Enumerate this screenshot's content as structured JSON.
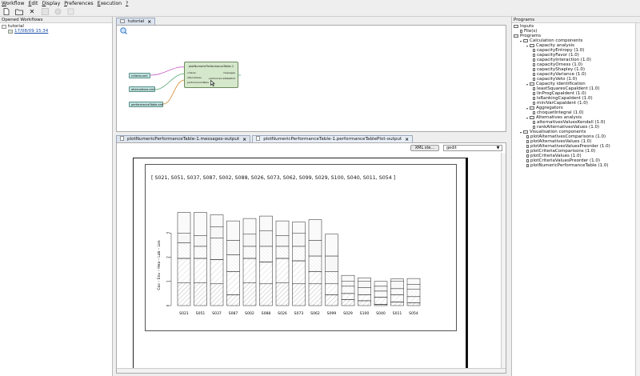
{
  "menu": [
    "Workflow",
    "Edit",
    "Display",
    "Preferences",
    "Execution",
    "?"
  ],
  "menu_underline_index": [
    0,
    0,
    0,
    0,
    0,
    0
  ],
  "left_panel": {
    "title": "Opened Workflows",
    "root": "tutorial",
    "child": "17/08/09 15:34"
  },
  "workflow_tab": "tutorial",
  "workflow": {
    "nodes": {
      "criteria": "criteria.xml",
      "alternatives": "alternatives.xml",
      "performanceTable": "performanceTable.xml",
      "plot": "plotNumericPerformanceTable-1"
    },
    "ports": {
      "in1": "criteria",
      "in2": "alternatives",
      "in3": "performanceTable",
      "out1": "messages",
      "out2": "performanceTablePlot"
    }
  },
  "output_tabs": [
    "plotNumericPerformanceTable-1.messages-output",
    "plotNumericPerformanceTable-1.performanceTablePlot-output"
  ],
  "output_toolbar": {
    "xml_button": "XML ste...",
    "viewer_select": "gedit"
  },
  "chart_data": {
    "type": "bar",
    "title": "[ S021, S051, S037, S087, S002, S088, S026, S073, S062, S099, S029, S100, S040, S011, S054 ]",
    "ylabel": "Cos – Env – Hea – Lab – Lon",
    "categories": [
      "S021",
      "S051",
      "S037",
      "S087",
      "S002",
      "S088",
      "S026",
      "S073",
      "S062",
      "S099",
      "S029",
      "S100",
      "S040",
      "S011",
      "S054"
    ],
    "series": [
      {
        "values": [
          0.95,
          0.95,
          0.9,
          0.45,
          0.95,
          0.9,
          0.95,
          0.9,
          0.9,
          0.45,
          0.25,
          0.2,
          0.05,
          0.15,
          0.12
        ]
      },
      {
        "values": [
          1.0,
          1.0,
          1.0,
          0.95,
          1.0,
          0.9,
          1.0,
          0.95,
          0.5,
          0.45,
          0.25,
          0.25,
          0.3,
          0.3,
          0.25
        ]
      },
      {
        "values": [
          0.65,
          0.5,
          0.9,
          0.7,
          0.5,
          0.65,
          0.5,
          0.6,
          0.65,
          0.5,
          0.3,
          0.3,
          0.25,
          0.25,
          0.3
        ]
      },
      {
        "values": [
          0.4,
          0.45,
          0.45,
          0.6,
          0.5,
          0.65,
          0.45,
          0.55,
          0.65,
          0.65,
          0.2,
          0.25,
          0.2,
          0.3,
          0.2
        ]
      },
      {
        "values": [
          0.85,
          0.95,
          0.5,
          0.8,
          0.65,
          0.6,
          0.6,
          0.45,
          0.85,
          0.9,
          0.25,
          0.15,
          0.2,
          0.1,
          0.25
        ]
      }
    ],
    "ylim": [
      0,
      4
    ],
    "yticks": [
      "0",
      "1",
      "2",
      "3",
      "4"
    ]
  },
  "right_panel": {
    "title": "Programs",
    "items": [
      {
        "level": 0,
        "type": "folder",
        "label": "Inputs"
      },
      {
        "level": 1,
        "type": "leaf",
        "label": "File(s)"
      },
      {
        "level": 0,
        "type": "folder",
        "label": "Programs"
      },
      {
        "level": 1,
        "type": "folder",
        "label": "Calculation components"
      },
      {
        "level": 2,
        "type": "folder",
        "label": "Capacity analysis"
      },
      {
        "level": 3,
        "type": "leaf",
        "label": "capacityEntropy (1.0)"
      },
      {
        "level": 3,
        "type": "leaf",
        "label": "capacityFavor (1.0)"
      },
      {
        "level": 3,
        "type": "leaf",
        "label": "capacityInteraction (1.0)"
      },
      {
        "level": 3,
        "type": "leaf",
        "label": "capacityOrness (1.0)"
      },
      {
        "level": 3,
        "type": "leaf",
        "label": "capacityShapley (1.0)"
      },
      {
        "level": 3,
        "type": "leaf",
        "label": "capacityVariance (1.0)"
      },
      {
        "level": 3,
        "type": "leaf",
        "label": "capacityVeto (1.0)"
      },
      {
        "level": 2,
        "type": "folder",
        "label": "Capacity identification"
      },
      {
        "level": 3,
        "type": "leaf",
        "label": "leastSquaresCapaIdent (1.0)"
      },
      {
        "level": 3,
        "type": "leaf",
        "label": "linProgCapaIdent (1.0)"
      },
      {
        "level": 3,
        "type": "leaf",
        "label": "lsRankingCapaIdent (1.0)"
      },
      {
        "level": 3,
        "type": "leaf",
        "label": "miniVarCapaIdent (1.0)"
      },
      {
        "level": 2,
        "type": "folder",
        "label": "Aggregators"
      },
      {
        "level": 3,
        "type": "leaf",
        "label": "choquetIntegral (1.0)"
      },
      {
        "level": 2,
        "type": "folder",
        "label": "Alternatives analysis"
      },
      {
        "level": 3,
        "type": "leaf",
        "label": "alternativesValuesKendall (1.0)"
      },
      {
        "level": 3,
        "type": "leaf",
        "label": "rankAlternativesValues (1.0)"
      },
      {
        "level": 1,
        "type": "folder",
        "label": "Visualisation components"
      },
      {
        "level": 2,
        "type": "leaf",
        "label": "plotAlternativesComparisons (1.0)"
      },
      {
        "level": 2,
        "type": "leaf",
        "label": "plotAlternativesValues (1.0)"
      },
      {
        "level": 2,
        "type": "leaf",
        "label": "plotAlternativesValuesPreorder (1.0)"
      },
      {
        "level": 2,
        "type": "leaf",
        "label": "plotCriteriaComparisons (1.0)"
      },
      {
        "level": 2,
        "type": "leaf",
        "label": "plotCriteriaValues (1.0)"
      },
      {
        "level": 2,
        "type": "leaf",
        "label": "plotCriteriaValuesPreorder (1.0)"
      },
      {
        "level": 2,
        "type": "leaf",
        "label": "plotNumericPerformanceTable (1.0)"
      }
    ]
  }
}
